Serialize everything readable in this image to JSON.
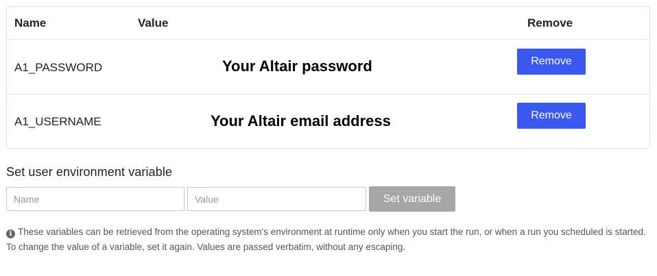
{
  "table": {
    "headers": {
      "name": "Name",
      "value": "Value",
      "remove": "Remove"
    },
    "rows": [
      {
        "name": "A1_PASSWORD",
        "value": "Your Altair password",
        "remove_label": "Remove"
      },
      {
        "name": "A1_USERNAME",
        "value": "Your Altair email address",
        "remove_label": "Remove"
      }
    ]
  },
  "set_variable": {
    "title": "Set user environment variable",
    "name_placeholder": "Name",
    "value_placeholder": "Value",
    "button_label": "Set variable"
  },
  "help": {
    "line1": "These variables can be retrieved from the operating system's environment at runtime only when you start the run, or when a run you scheduled is started.",
    "line2": "To change the value of a variable, set it again. Values are passed verbatim, without any escaping."
  },
  "icons": {
    "info": "info-circle-icon"
  },
  "colors": {
    "remove_button": "#3a58f0",
    "set_button_disabled": "#a6a6a6"
  }
}
